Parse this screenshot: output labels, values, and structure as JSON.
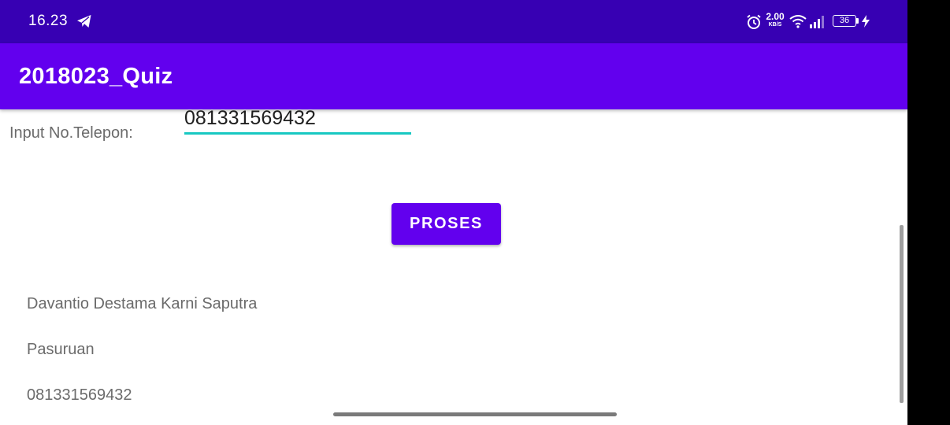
{
  "status_bar": {
    "time": "16.23",
    "net_speed_value": "2.00",
    "net_speed_unit": "KB/S",
    "battery_level": "36",
    "icons": [
      "telegram-icon",
      "alarm-icon",
      "wifi-icon",
      "signal-icon",
      "battery-icon",
      "charging-bolt-icon"
    ]
  },
  "app_bar": {
    "title": "2018023_Quiz"
  },
  "form": {
    "phone_label": "Input No.Telepon:",
    "phone_value": "081331569432",
    "submit_label": "PROSES"
  },
  "results": {
    "name": "Davantio Destama Karni  Saputra",
    "city": "Pasuruan",
    "phone": "081331569432"
  },
  "colors": {
    "status_bar": "#3700b3",
    "primary": "#6200ee",
    "input_underline": "#18c8c2",
    "secondary_text": "#6b6b6b"
  }
}
